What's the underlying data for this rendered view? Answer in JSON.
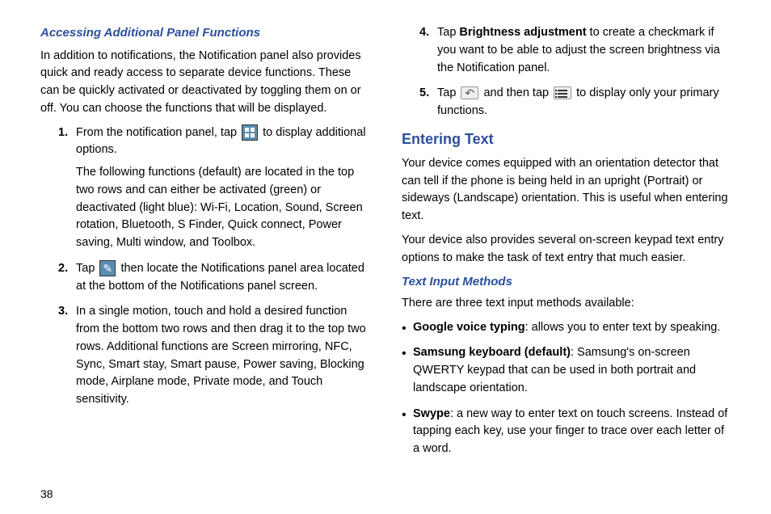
{
  "left": {
    "heading": "Accessing Additional Panel Functions",
    "intro": "In addition to notifications, the Notification panel also provides quick and ready access to separate device functions. These can be quickly activated or deactivated by toggling them on or off. You can choose the functions that will be displayed.",
    "step1a": "From the notification panel, tap ",
    "step1b": " to display additional options.",
    "step1c": "The following functions (default) are located in the top two rows and can either be activated (green) or deactivated (light blue): Wi-Fi, Location, Sound, Screen rotation, Bluetooth, S Finder, Quick connect, Power saving, Multi window, and Toolbox.",
    "step2a": "Tap ",
    "step2b": " then locate the Notifications panel area located at the bottom of the Notifications panel screen.",
    "step3": "In a single motion, touch and hold a desired function from the bottom two rows and then drag it to the top two rows. Additional functions are Screen mirroring, NFC, Sync, Smart stay, Smart pause, Power saving, Blocking mode, Airplane mode, Private mode, and Touch sensitivity."
  },
  "right": {
    "step4a": "Tap ",
    "step4b": "Brightness adjustment",
    "step4c": " to create a checkmark if you want to be able to adjust the screen brightness via the Notification panel.",
    "step5a": "Tap ",
    "step5b": " and then tap ",
    "step5c": " to display only your primary functions.",
    "h2": "Entering Text",
    "p1": "Your device comes equipped with an orientation detector that can tell if the phone is being held in an upright (Portrait) or sideways (Landscape) orientation. This is useful when entering text.",
    "p2": "Your device also provides several on-screen keypad text entry options to make the task of text entry that much easier.",
    "h3": "Text Input Methods",
    "p3": "There are three text input methods available:",
    "b1a": "Google voice typing",
    "b1b": ": allows you to enter text by speaking.",
    "b2a": "Samsung keyboard (default)",
    "b2b": ": Samsung's on-screen QWERTY keypad that can be used in both portrait and landscape orientation.",
    "b3a": "Swype",
    "b3b": ": a new way to enter text on touch screens. Instead of tapping each key, use your finger to trace over each letter of a word."
  },
  "pageNumber": "38",
  "nums": {
    "n1": "1.",
    "n2": "2.",
    "n3": "3.",
    "n4": "4.",
    "n5": "5."
  }
}
